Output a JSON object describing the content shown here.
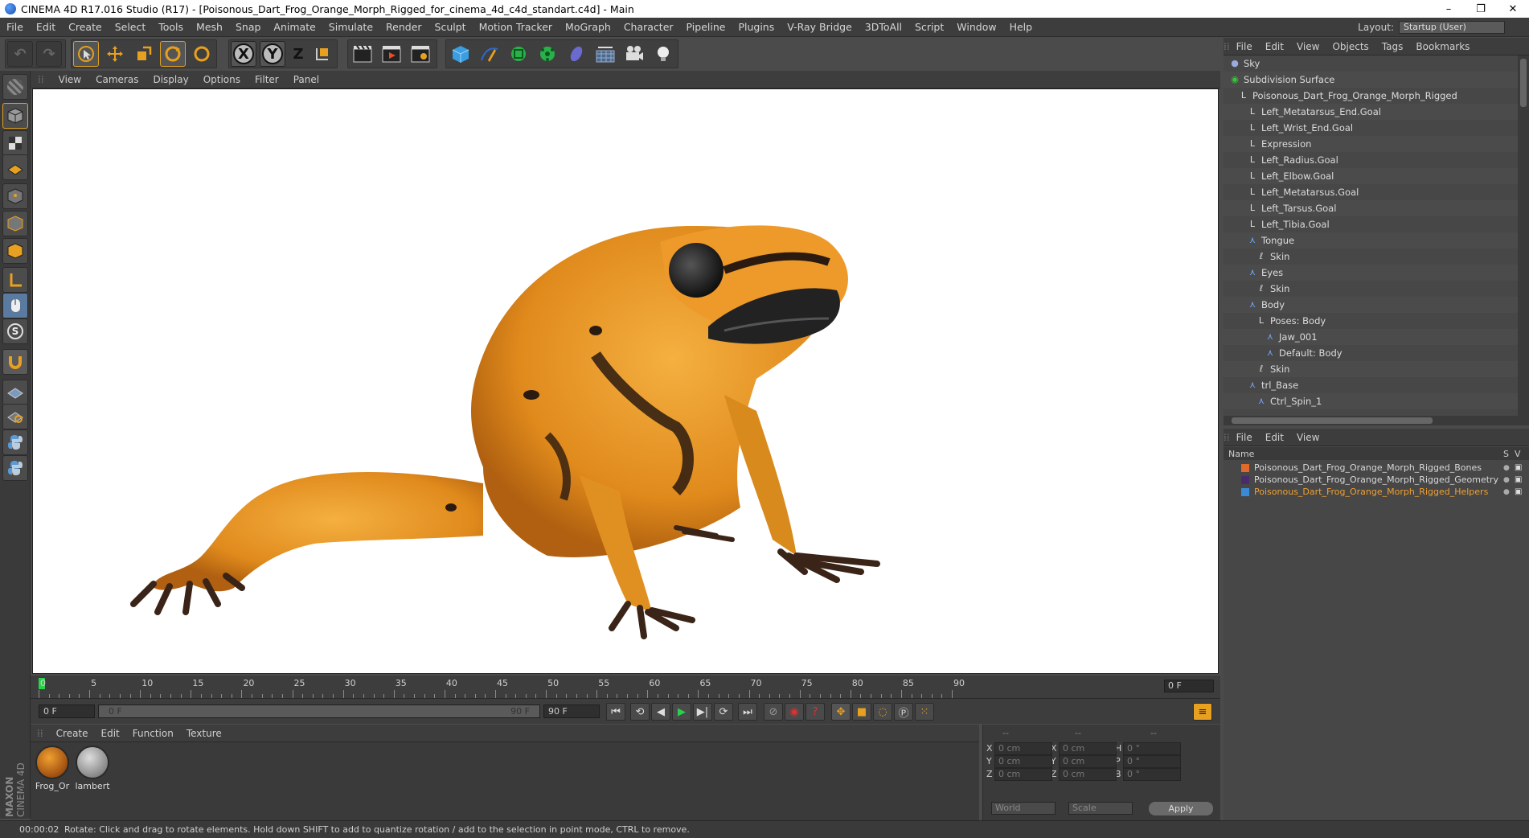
{
  "window": {
    "title": "CINEMA 4D R17.016 Studio (R17) - [Poisonous_Dart_Frog_Orange_Morph_Rigged_for_cinema_4d_c4d_standart.c4d] - Main",
    "controls": [
      "–",
      "❐",
      "✕"
    ]
  },
  "menu": {
    "items": [
      "File",
      "Edit",
      "Create",
      "Select",
      "Tools",
      "Mesh",
      "Snap",
      "Animate",
      "Simulate",
      "Render",
      "Sculpt",
      "Motion Tracker",
      "MoGraph",
      "Character",
      "Pipeline",
      "Plugins",
      "V-Ray Bridge",
      "3DToAll",
      "Script",
      "Window",
      "Help"
    ],
    "layout_label": "Layout:",
    "layout_value": "Startup (User)"
  },
  "toolbar": {
    "axis_x": "X",
    "axis_y": "Y",
    "axis_z": "Z"
  },
  "viewport": {
    "menu": [
      "View",
      "Cameras",
      "Display",
      "Options",
      "Filter",
      "Panel"
    ]
  },
  "timeline": {
    "ticks": [
      "0",
      "5",
      "10",
      "15",
      "20",
      "25",
      "30",
      "35",
      "40",
      "45",
      "50",
      "55",
      "60",
      "65",
      "70",
      "75",
      "80",
      "85",
      "90"
    ],
    "current_frame": "0 F"
  },
  "transport": {
    "start_field": "0 F",
    "range_start": "0 F",
    "range_end": "90 F",
    "end_field": "90 F"
  },
  "material_manager": {
    "menu": [
      "Create",
      "Edit",
      "Function",
      "Texture"
    ],
    "materials": [
      {
        "name": "Frog_Or"
      },
      {
        "name": "lambert"
      }
    ]
  },
  "coordinates": {
    "headers": [
      "--",
      "--",
      "--"
    ],
    "rows": [
      {
        "l1": "X",
        "v1": "0 cm",
        "l2": "X",
        "v2": "0 cm",
        "l3": "H",
        "v3": "0 °"
      },
      {
        "l1": "Y",
        "v1": "0 cm",
        "l2": "Y",
        "v2": "0 cm",
        "l3": "P",
        "v3": "0 °"
      },
      {
        "l1": "Z",
        "v1": "0 cm",
        "l2": "Z",
        "v2": "0 cm",
        "l3": "B",
        "v3": "0 °"
      }
    ],
    "world_select": "World",
    "scale_select": "Scale",
    "apply_label": "Apply"
  },
  "status": {
    "time": "00:00:02",
    "message": "Rotate: Click and drag to rotate elements. Hold down SHIFT to add to quantize rotation / add to the selection in point mode, CTRL to remove."
  },
  "object_manager": {
    "menu": [
      "File",
      "Edit",
      "View",
      "Objects",
      "Tags",
      "Bookmarks"
    ],
    "objects": [
      {
        "name": "Sky",
        "indent": 0,
        "icon": "sky-icon"
      },
      {
        "name": "Subdivision Surface",
        "indent": 0,
        "icon": "subdivision-icon"
      },
      {
        "name": "Poisonous_Dart_Frog_Orange_Morph_Rigged",
        "indent": 1,
        "icon": "null-icon"
      },
      {
        "name": "Left_Metatarsus_End.Goal",
        "indent": 2,
        "icon": "null-icon"
      },
      {
        "name": "Left_Wrist_End.Goal",
        "indent": 2,
        "icon": "null-icon"
      },
      {
        "name": "Expression",
        "indent": 2,
        "icon": "null-icon"
      },
      {
        "name": "Left_Radius.Goal",
        "indent": 2,
        "icon": "null-icon"
      },
      {
        "name": "Left_Elbow.Goal",
        "indent": 2,
        "icon": "null-icon"
      },
      {
        "name": "Left_Metatarsus.Goal",
        "indent": 2,
        "icon": "null-icon"
      },
      {
        "name": "Left_Tarsus.Goal",
        "indent": 2,
        "icon": "null-icon"
      },
      {
        "name": "Left_Tibia.Goal",
        "indent": 2,
        "icon": "null-icon"
      },
      {
        "name": "Tongue",
        "indent": 2,
        "icon": "joint-icon"
      },
      {
        "name": "Skin",
        "indent": 3,
        "icon": "skin-icon"
      },
      {
        "name": "Eyes",
        "indent": 2,
        "icon": "joint-icon"
      },
      {
        "name": "Skin",
        "indent": 3,
        "icon": "skin-icon"
      },
      {
        "name": "Body",
        "indent": 2,
        "icon": "joint-icon"
      },
      {
        "name": "Poses: Body",
        "indent": 3,
        "icon": "null-icon"
      },
      {
        "name": "Jaw_001",
        "indent": 4,
        "icon": "joint-icon"
      },
      {
        "name": "Default: Body",
        "indent": 4,
        "icon": "joint-icon"
      },
      {
        "name": "Skin",
        "indent": 3,
        "icon": "skin-icon"
      },
      {
        "name": "trl_Base",
        "indent": 2,
        "icon": "joint-icon"
      },
      {
        "name": "Ctrl_Spin_1",
        "indent": 3,
        "icon": "joint-icon"
      }
    ]
  },
  "layer_manager": {
    "menu": [
      "File",
      "Edit",
      "View"
    ],
    "col_name": "Name",
    "col_s": "S",
    "col_v": "V",
    "layers": [
      {
        "name": "Poisonous_Dart_Frog_Orange_Morph_Rigged_Bones",
        "color": "#e06a2a",
        "text_color": "#d8d8d8"
      },
      {
        "name": "Poisonous_Dart_Frog_Orange_Morph_Rigged_Geometry",
        "color": "#4a2a6a",
        "text_color": "#d8d8d8"
      },
      {
        "name": "Poisonous_Dart_Frog_Orange_Morph_Rigged_Helpers",
        "color": "#3a8ad8",
        "text_color": "#f0a030"
      }
    ]
  },
  "branding": {
    "logo_text": "MAXON CINEMA 4D"
  }
}
